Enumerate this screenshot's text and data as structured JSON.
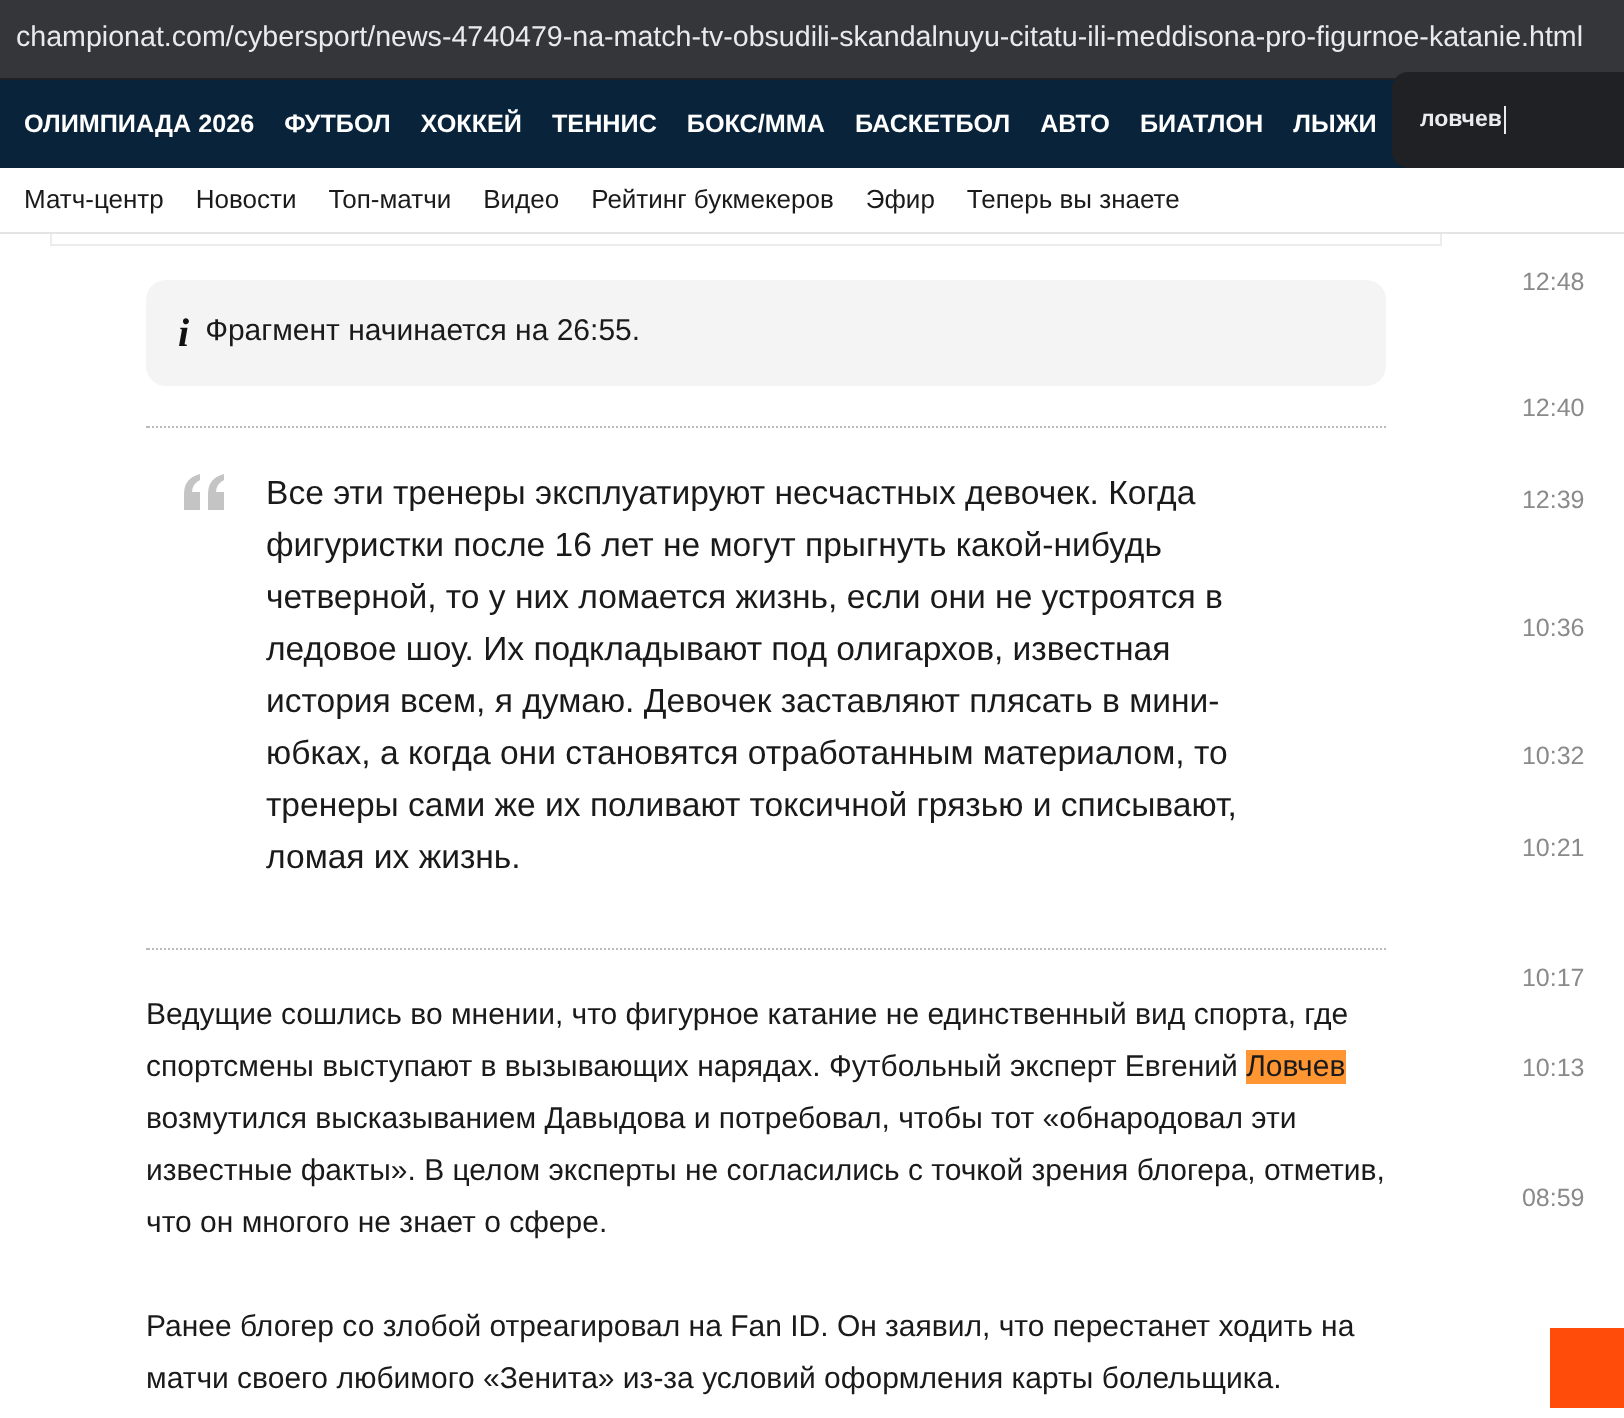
{
  "address_bar": {
    "url": "championat.com/cybersport/news-4740479-na-match-tv-obsudili-skandalnuyu-citatu-ili-meddisona-pro-figurnoe-katanie.html"
  },
  "main_nav": [
    "ОЛИМПИАДА 2026",
    "ФУТБОЛ",
    "ХОККЕЙ",
    "ТЕННИС",
    "БОКС/ММА",
    "БАСКЕТБОЛ",
    "АВТО",
    "БИАТЛОН",
    "ЛЫЖИ"
  ],
  "find_bar": {
    "value": "ловчев"
  },
  "sub_nav": [
    "Матч-центр",
    "Новости",
    "Топ-матчи",
    "Видео",
    "Рейтинг букмекеров",
    "Эфир",
    "Теперь вы знаете"
  ],
  "info_note": {
    "icon": "i",
    "text": "Фрагмент начинается на 26:55."
  },
  "quote": {
    "text": "Все эти тренеры эксплуатируют несчастных девочек. Когда фигуристки после 16 лет не могут прыгнуть какой-нибудь четверной, то у них ломается жизнь, если они не устроятся в ледовое шоу. Их подкладывают под олигархов, известная история всем, я думаю. Девочек заставляют плясать в мини-юбках, а когда они становятся отработанным материалом, то тренеры сами же их поливают токсичной грязью и списывают, ломая их жизнь."
  },
  "paragraphs": [
    {
      "parts": [
        {
          "text": "Ведущие сошлись во мнении, что фигурное катание не единственный вид спорта, где спортсмены выступают в вызывающих нарядах. Футбольный эксперт Евгений ",
          "highlighted": false
        },
        {
          "text": "Ловчев",
          "highlighted": true
        },
        {
          "text": " возмутился высказыванием Давыдова и потребовал, чтобы тот «обнародовал эти известные факты». В целом эксперты не согласились с точкой зрения блогера, отметив, что он многого не знает о сфере.",
          "highlighted": false
        }
      ]
    },
    {
      "parts": [
        {
          "text": "Ранее блогер со злобой отреагировал на Fan ID. Он заявил, что перестанет ходить на матчи своего любимого «Зенита» из-за условий оформления карты болельщика.",
          "highlighted": false
        }
      ]
    }
  ],
  "news_times": [
    "12:48",
    "12:40",
    "12:39",
    "10:36",
    "10:32",
    "10:21",
    "10:17",
    "10:13",
    "08:59"
  ]
}
